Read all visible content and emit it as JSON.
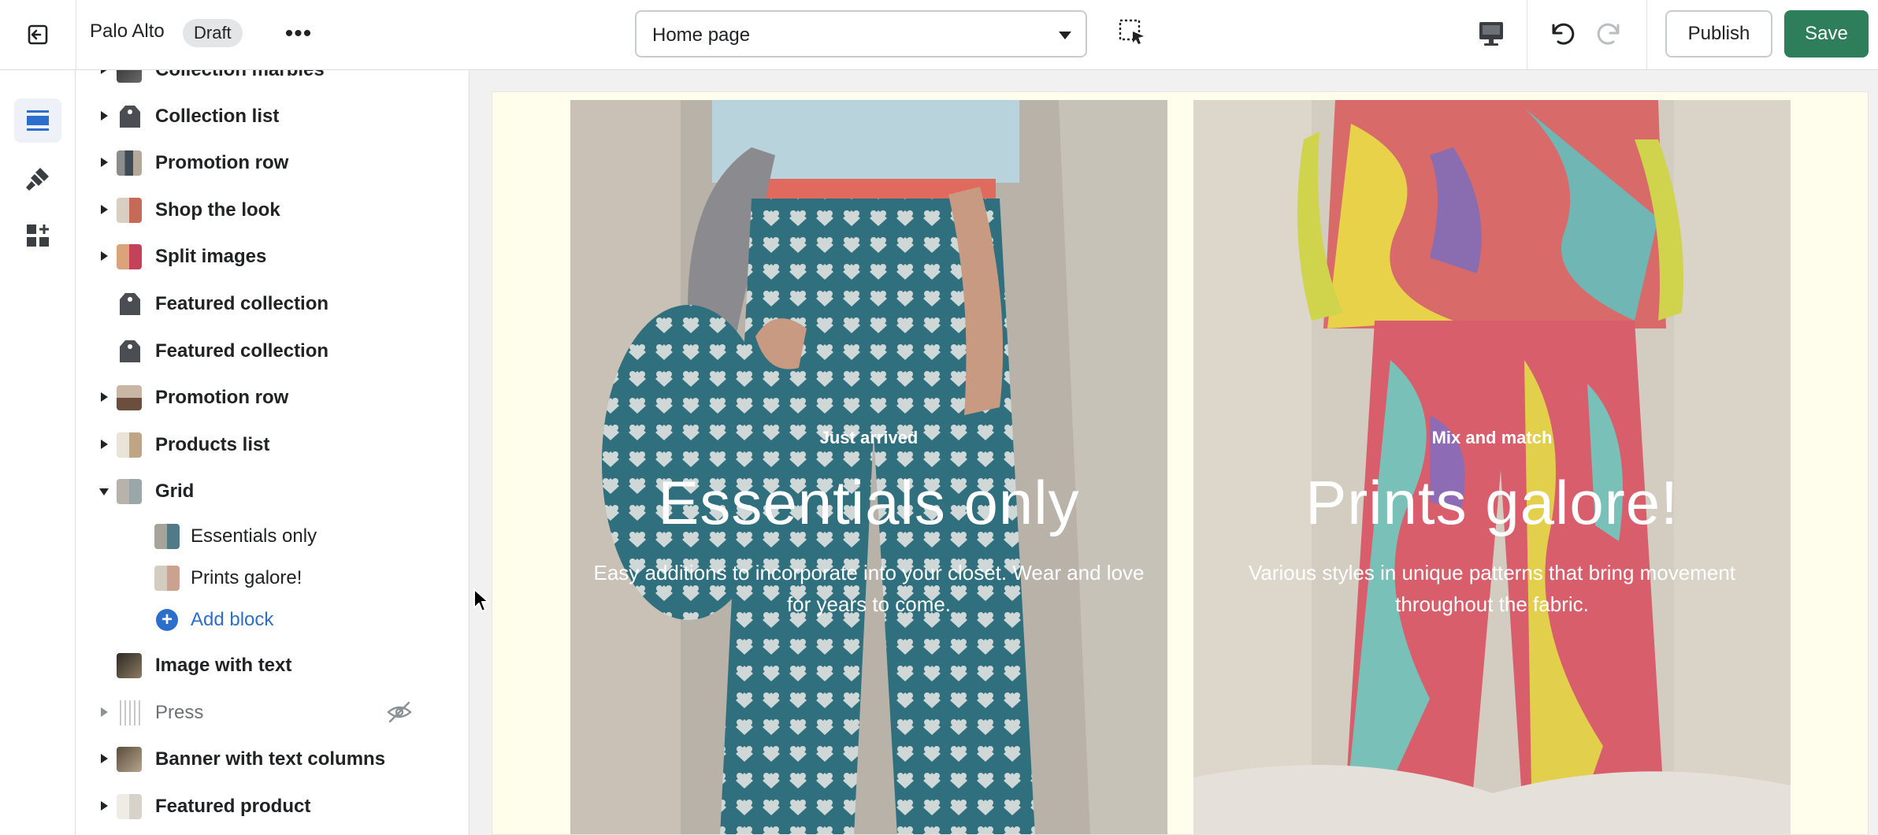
{
  "topbar": {
    "store_name": "Palo Alto",
    "status_badge": "Draft",
    "more_label": "•••",
    "page_selector": {
      "value": "Home page"
    },
    "publish_label": "Publish",
    "save_label": "Save"
  },
  "rail": {
    "items": [
      {
        "icon": "sections-icon",
        "active": true
      },
      {
        "icon": "theme-settings-icon",
        "active": false
      },
      {
        "icon": "app-embeds-icon",
        "active": false
      }
    ]
  },
  "sidebar": {
    "items": [
      {
        "label": "Collection marbles"
      },
      {
        "label": "Collection list"
      },
      {
        "label": "Promotion row"
      },
      {
        "label": "Shop the look"
      },
      {
        "label": "Split images"
      },
      {
        "label": "Featured collection"
      },
      {
        "label": "Featured collection"
      },
      {
        "label": "Promotion row"
      },
      {
        "label": "Products list"
      },
      {
        "label": "Grid",
        "expanded": true,
        "blocks": [
          {
            "label": "Essentials only"
          },
          {
            "label": "Prints galore!"
          }
        ],
        "add_block_label": "Add block"
      },
      {
        "label": "Image with text"
      },
      {
        "label": "Press",
        "hidden": true
      },
      {
        "label": "Banner with text columns"
      },
      {
        "label": "Featured product"
      }
    ]
  },
  "preview": {
    "cards": [
      {
        "kicker": "Just arrived",
        "headline": "Essentials only",
        "body": "Easy additions to incorporate into your closet. Wear and love for years to come."
      },
      {
        "kicker": "Mix and match",
        "headline": "Prints galore!",
        "body": "Various styles in unique patterns that bring movement throughout the fabric."
      }
    ]
  },
  "colors": {
    "save_button": "#2e7d5b",
    "link": "#2c6ecb",
    "preview_background": "#fffdec"
  }
}
